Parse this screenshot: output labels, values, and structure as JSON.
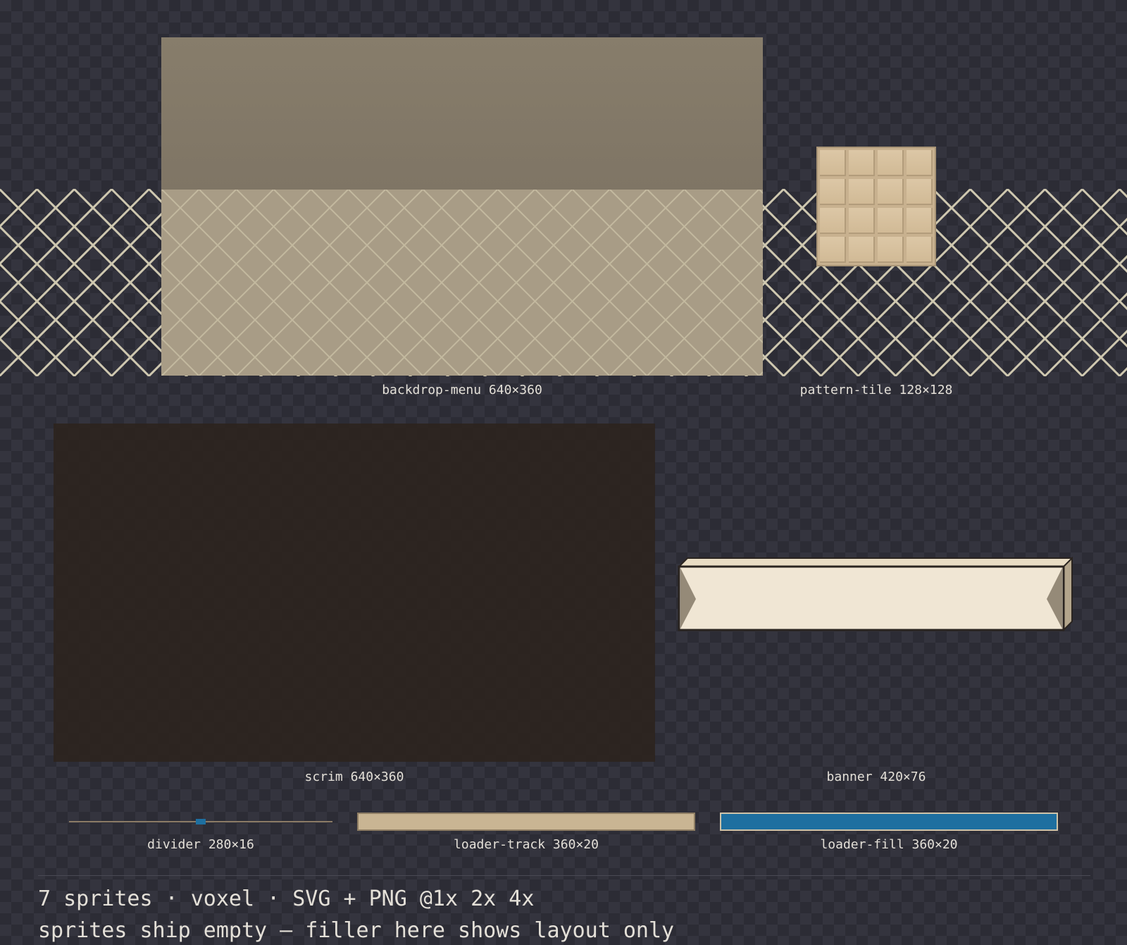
{
  "sprites": [
    {
      "id": "backdrop-menu",
      "caption": "backdrop-menu 640×360"
    },
    {
      "id": "pattern-tile",
      "caption": "pattern-tile 128×128"
    },
    {
      "id": "scrim",
      "caption": "scrim 640×360"
    },
    {
      "id": "banner",
      "caption": "banner 420×76"
    },
    {
      "id": "divider",
      "caption": "divider 280×16"
    },
    {
      "id": "loader-track",
      "caption": "loader-track 360×20"
    },
    {
      "id": "loader-fill",
      "caption": "loader-fill 360×20"
    }
  ],
  "footer": {
    "summary": "7 sprites · voxel · SVG + PNG @1x 2x 4x",
    "note": "sprites ship empty — filler here shows layout only"
  },
  "colors": {
    "checker_dark": "#2c2c35",
    "checker_light": "#34343e",
    "lattice": "#cfc8b0",
    "accent_blue": "#1e6fa0",
    "banner_face": "#f0e6d4",
    "tan": "#c9b593"
  }
}
